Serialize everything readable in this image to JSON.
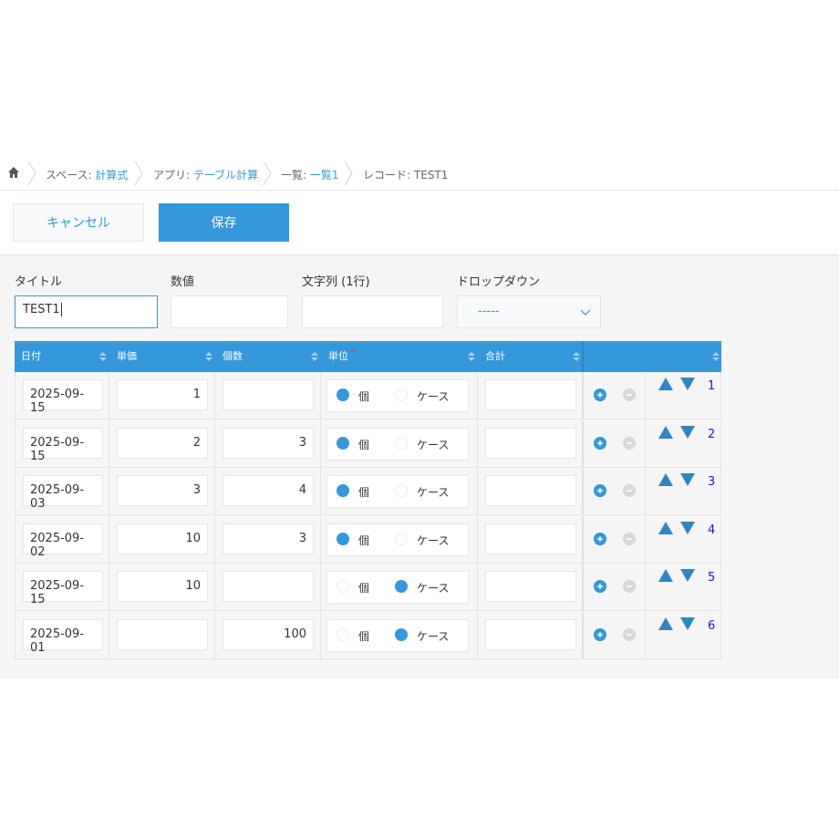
{
  "breadcrumb": {
    "items": [
      {
        "prefix": "スペース: ",
        "link": "計算式"
      },
      {
        "prefix": "アプリ: ",
        "link": "テーブル計算"
      },
      {
        "prefix": "一覧: ",
        "link": "一覧1"
      },
      {
        "prefix": "レコード: TEST1",
        "link": ""
      }
    ]
  },
  "toolbar": {
    "cancel_label": "キャンセル",
    "save_label": "保存"
  },
  "form": {
    "title_label": "タイトル",
    "title_value": "TEST1",
    "number_label": "数値",
    "number_value": "",
    "text_label": "文字列 (1行)",
    "text_value": "",
    "dropdown_label": "ドロップダウン",
    "dropdown_value": "-----"
  },
  "table": {
    "headers": {
      "date": "日付",
      "price": "単価",
      "qty": "個数",
      "unit": "単位",
      "required_mark": "*",
      "total": "合計"
    },
    "unit_options": [
      "個",
      "ケース"
    ],
    "rows": [
      {
        "date": "2025-09-15",
        "price": "1",
        "qty": "",
        "unit": "個",
        "total": "",
        "index": "1"
      },
      {
        "date": "2025-09-15",
        "price": "2",
        "qty": "3",
        "unit": "個",
        "total": "",
        "index": "2"
      },
      {
        "date": "2025-09-03",
        "price": "3",
        "qty": "4",
        "unit": "個",
        "total": "",
        "index": "3"
      },
      {
        "date": "2025-09-02",
        "price": "10",
        "qty": "3",
        "unit": "個",
        "total": "",
        "index": "4"
      },
      {
        "date": "2025-09-15",
        "price": "10",
        "qty": "",
        "unit": "ケース",
        "total": "",
        "index": "5"
      },
      {
        "date": "2025-09-01",
        "price": "",
        "qty": "100",
        "unit": "ケース",
        "total": "",
        "index": "6"
      }
    ]
  },
  "colors": {
    "accent": "#3498db",
    "disabled": "#d8d8d8",
    "row_index": "#1a1adb"
  },
  "icons": [
    "home-icon",
    "sort-icon",
    "chevron-down-icon",
    "add-row-icon",
    "remove-row-icon",
    "move-up-icon",
    "move-down-icon"
  ]
}
